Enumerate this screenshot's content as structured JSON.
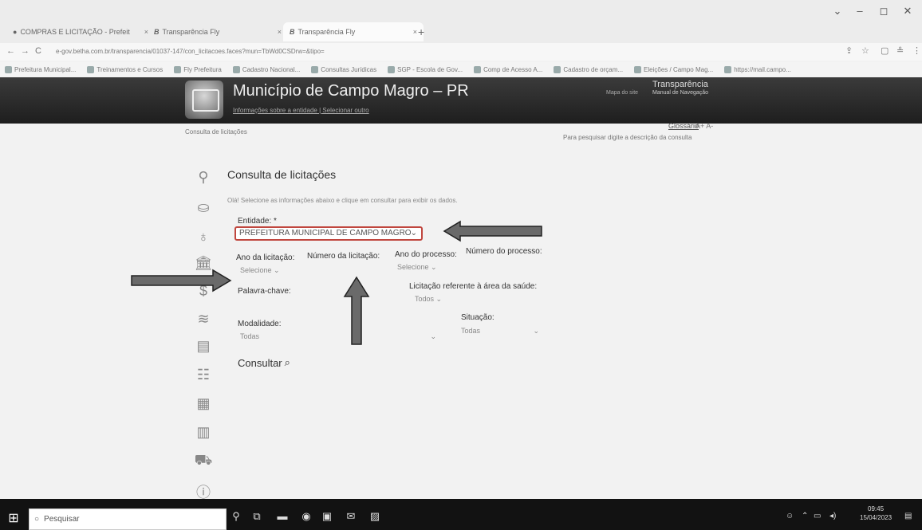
{
  "browser": {
    "tabs": [
      {
        "label": "COMPRAS E LICITAÇÃO - Prefeit"
      },
      {
        "label": "Transparência Fly"
      },
      {
        "label": "Transparência Fly"
      }
    ],
    "new_tab": "+",
    "url": "e-gov.betha.com.br/transparencia/01037-147/con_licitacoes.faces?mun=TbWd0CSDrw=&tipo=",
    "bookmarks": [
      "Prefeitura Municipal...",
      "Treinamentos e Cursos",
      "Fly Prefeitura",
      "Cadastro Nacional...",
      "Consultas Jurídicas",
      "SGP - Escola de Gov...",
      "Comp de Acesso A...",
      "Cadastro de orçam...",
      "Eleições / Campo Mag...",
      "https://mail.campo..."
    ]
  },
  "site": {
    "title": "Município de Campo Magro – PR",
    "subtitle": "Informações sobre a entidade | Selecionar outro",
    "transparencia": "Transparência",
    "mapa": "Mapa do site",
    "manual": "Manual de Navegação",
    "breadcrumb": "Consulta de licitações",
    "glossario": "Glossário",
    "font_controls": "A+ A-",
    "hint": "Para pesquisar digite a descrição da consulta"
  },
  "form": {
    "title": "Consulta de licitações",
    "description": "Olá! Selecione as informações abaixo e clique em consultar para exibir os dados.",
    "entidade_label": "Entidade: *",
    "entidade_value": "PREFEITURA MUNICIPAL DE CAMPO MAGRO",
    "ano_licitacao_label": "Ano da licitação:",
    "ano_licitacao_value": "Selecione",
    "numero_licitacao_label": "Número da licitação:",
    "ano_processo_label": "Ano do processo:",
    "ano_processo_value": "Selecione",
    "numero_processo_label": "Número do processo:",
    "palavra_chave_label": "Palavra-chave:",
    "saude_label": "Licitação referente à área da saúde:",
    "saude_value": "Todos",
    "modalidade_label": "Modalidade:",
    "modalidade_value": "Todas",
    "situacao_label": "Situação:",
    "situacao_value": "Todas",
    "consultar_label": "Consultar"
  },
  "taskbar": {
    "search_placeholder": "Pesquisar",
    "time": "09:45",
    "date": "15/04/2023"
  },
  "colors": {
    "header_dark": "#2a2a2a",
    "annotation_arrow": "#6a6a6a",
    "select_border": "#c0463e"
  }
}
